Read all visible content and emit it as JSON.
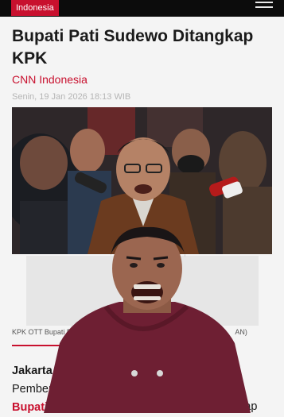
{
  "header": {
    "category_tag": "Indonesia",
    "menu_icon": "hamburger-menu-icon"
  },
  "article": {
    "headline": "Bupati Pati Sudewo Ditangkap KPK",
    "source": "CNN Indonesia",
    "date": "Senin, 19 Jan 2026 18:13 WIB",
    "photo_caption": "KPK OTT Bupati Pati",
    "photo_caption_end": "AN)",
    "body_lines": [
      "Jakarta",
      "Pember",
      "Bupati"
    ],
    "body_right_lines": [
      "p",
      "kap"
    ]
  },
  "colors": {
    "brand_red": "#c8102e",
    "topbar": "#0c0c0c",
    "page_bg": "#f4f4f4"
  }
}
